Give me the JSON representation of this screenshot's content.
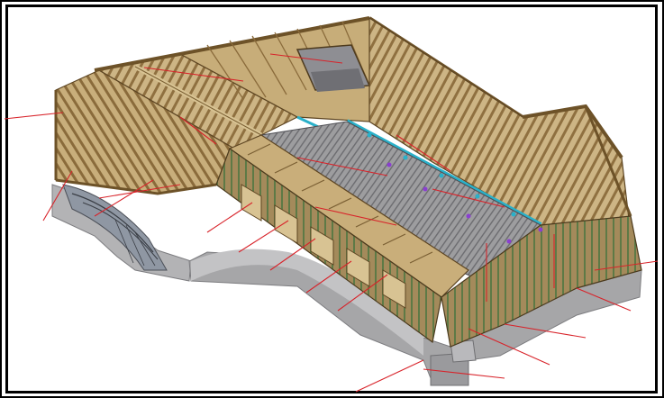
{
  "image": {
    "subject": "",
    "colors": {
      "timber": "#b89a66",
      "timber_dark": "#7a5f33",
      "timber_light": "#d8c393",
      "concrete": "#a9a9ab",
      "concrete_dark": "#8d8d90",
      "concrete_light": "#c7c7c9",
      "red_line": "#d8232a",
      "cyan_member": "#2ab0c9",
      "green_member": "#4f8a4a",
      "purple_node": "#8a3fd1",
      "frame_border": "#000000"
    }
  }
}
